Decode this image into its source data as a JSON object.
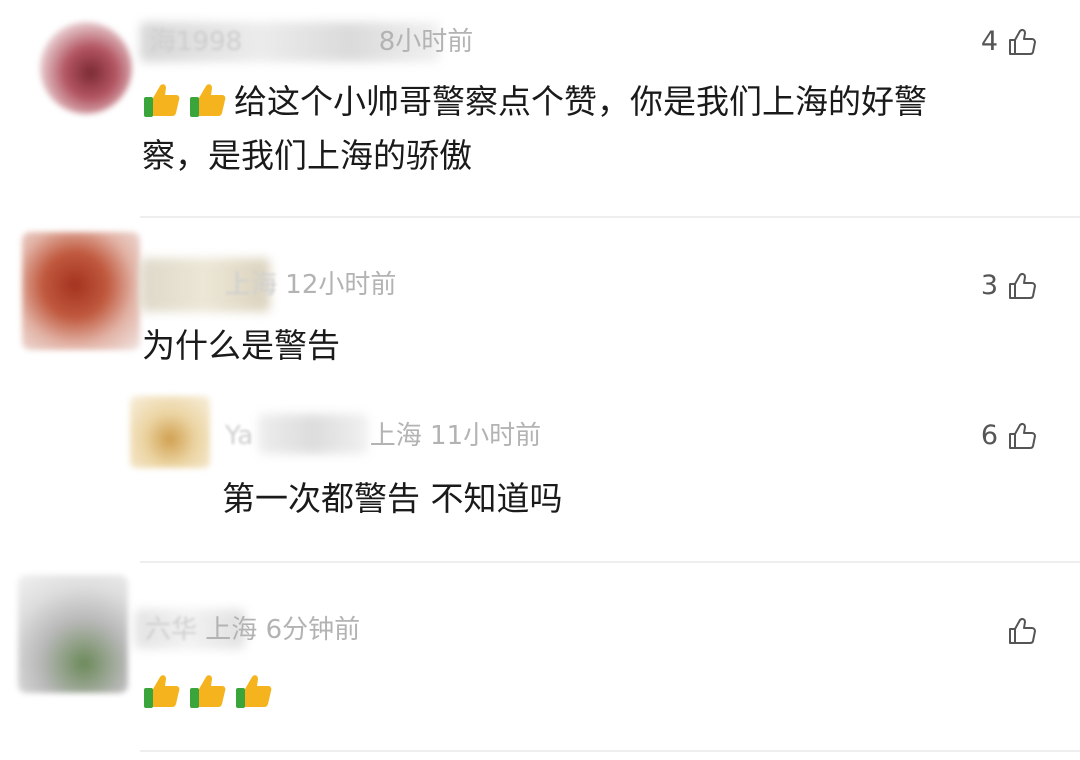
{
  "comments": [
    {
      "name": "海1998",
      "time": "8小时前",
      "likes": "4",
      "text_line1": "给这个小帅哥警察点个赞，你是我们上海的好警",
      "text_line2": "察，是我们上海的骄傲",
      "emoji": [
        "thumbs-up",
        "thumbs-up"
      ]
    },
    {
      "name": "",
      "location": "上海",
      "time": "12小时前",
      "likes": "3",
      "text": "为什么是警告",
      "reply": {
        "name": "Ya",
        "location": "上海",
        "time": "11小时前",
        "likes": "6",
        "text": "第一次都警告 不知道吗"
      }
    },
    {
      "name": "六华",
      "location": "上海",
      "time": "6分钟前",
      "likes": "",
      "emoji": [
        "thumbs-up",
        "thumbs-up",
        "thumbs-up"
      ]
    }
  ],
  "colors": {
    "meta": "#b3b3b3",
    "text": "#1a1a1a",
    "divider": "#eeeeee",
    "emoji_yellow": "#f5b41e",
    "emoji_cuff": "#3aa53a"
  }
}
